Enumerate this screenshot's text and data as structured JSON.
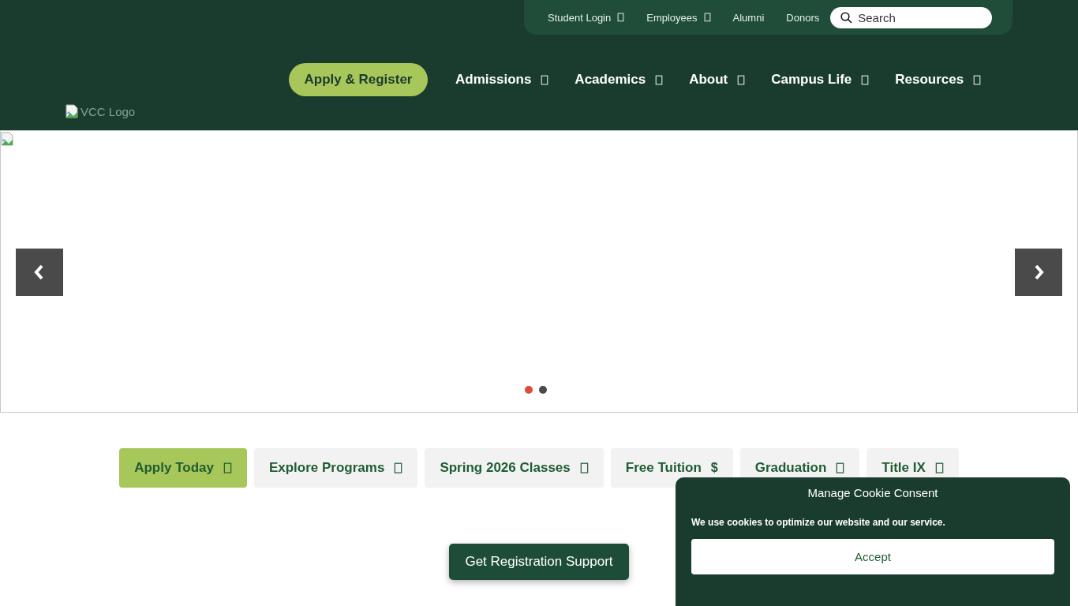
{
  "utility_nav": {
    "links": [
      {
        "label": "Student Login",
        "dropdown": true
      },
      {
        "label": "Employees",
        "dropdown": true
      },
      {
        "label": "Alumni",
        "dropdown": false
      },
      {
        "label": "Donors",
        "dropdown": false
      }
    ],
    "search": {
      "placeholder": "Search"
    }
  },
  "logo": {
    "alt_text": "VCC Logo"
  },
  "main_nav": {
    "cta": "Apply & Register",
    "items": [
      {
        "label": "Admissions",
        "dropdown": true
      },
      {
        "label": "Academics",
        "dropdown": true
      },
      {
        "label": "About",
        "dropdown": true
      },
      {
        "label": "Campus Life",
        "dropdown": true
      },
      {
        "label": "Resources",
        "dropdown": true
      }
    ]
  },
  "hero": {
    "slides": [
      {
        "selected": true
      },
      {
        "selected": false
      }
    ]
  },
  "quick_links": [
    {
      "label": "Apply Today",
      "highlighted": true,
      "kind": "glyph"
    },
    {
      "label": "Explore Programs",
      "highlighted": false,
      "kind": "glyph"
    },
    {
      "label": "Spring 2026 Classes",
      "highlighted": false,
      "kind": "glyph"
    },
    {
      "label": "Free Tuition",
      "highlighted": false,
      "kind": "symbol",
      "symbol": "$"
    },
    {
      "label": "Graduation",
      "highlighted": false,
      "kind": "glyph"
    },
    {
      "label": "Title IX",
      "highlighted": false,
      "kind": "glyph"
    }
  ],
  "registration_button": "Get Registration Support",
  "cookie_consent": {
    "title": "Manage Cookie Consent",
    "message": "We use cookies to optimize our website and our service.",
    "button": "Accept"
  }
}
